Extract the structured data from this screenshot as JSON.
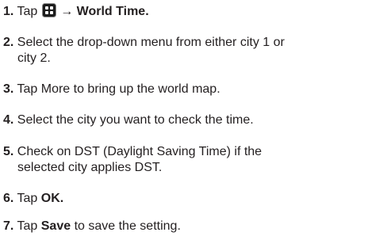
{
  "steps": [
    {
      "number": "1.",
      "pre": "Tap",
      "arrow": "→",
      "bold": "World Time."
    },
    {
      "number": "2.",
      "line1": "Select the drop-down menu from either city 1 or",
      "line2": "city 2."
    },
    {
      "number": "3.",
      "text": "Tap More to bring up the world map."
    },
    {
      "number": "4.",
      "text": "Select the city you want to check the time."
    },
    {
      "number": "5.",
      "line1": "Check on DST (Daylight Saving Time) if the",
      "line2": "selected city applies DST."
    },
    {
      "number": "6.",
      "pre": "Tap",
      "bold": "OK."
    },
    {
      "number": "7.",
      "pre": "Tap",
      "bold": "Save",
      "post": "to save the setting."
    }
  ],
  "icons": {
    "applications": "apps-grid-icon"
  },
  "colors": {
    "text": "#231f20",
    "icon_bg": "#1c1c1c",
    "icon_fg": "#ffffff"
  }
}
